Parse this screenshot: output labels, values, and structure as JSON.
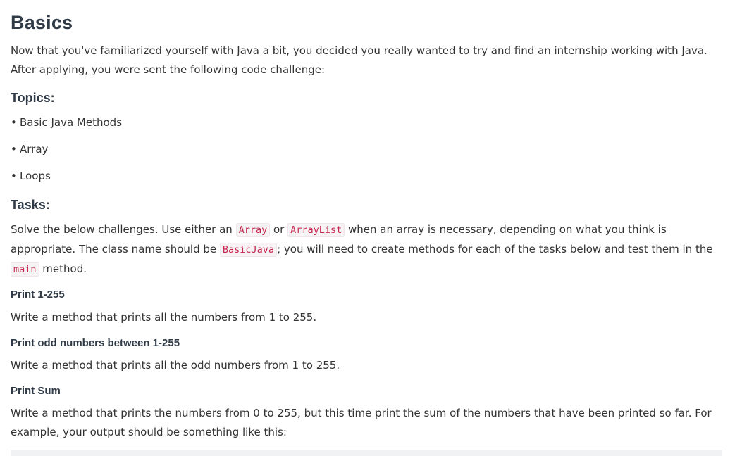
{
  "title": "Basics",
  "intro": {
    "line1": "Now that you've familiarized yourself with Java a bit, you decided you really wanted to try and find an internship working with Java.",
    "line2": "After applying, you were sent the following code challenge:"
  },
  "topics": {
    "heading": "Topics:",
    "items": [
      "Basic Java Methods",
      "Array",
      "Loops"
    ],
    "bullet": "•"
  },
  "tasks": {
    "heading": "Tasks:",
    "desc": {
      "p1": "Solve the below challenges. Use either an ",
      "code1": "Array",
      "p2": " or ",
      "code2": "ArrayList",
      "p3": " when an array is necessary, depending on what you think is",
      "p4": "appropriate. The class name should be ",
      "code3": "BasicJava",
      "p5": "; you will need to create methods for each of the tasks below and test them in the",
      "code4": "main",
      "p6": " method."
    }
  },
  "sections": [
    {
      "heading": "Print 1-255",
      "lines": [
        "Write a method that prints all the numbers from 1 to 255."
      ]
    },
    {
      "heading": "Print odd numbers between 1-255",
      "lines": [
        "Write a method that prints all the odd numbers from 1 to 255."
      ]
    },
    {
      "heading": "Print Sum",
      "lines": [
        "Write a method that prints the numbers from 0 to 255, but this time print the sum of the numbers that have been printed so far. For",
        "example, your output should be something like this:"
      ]
    }
  ]
}
